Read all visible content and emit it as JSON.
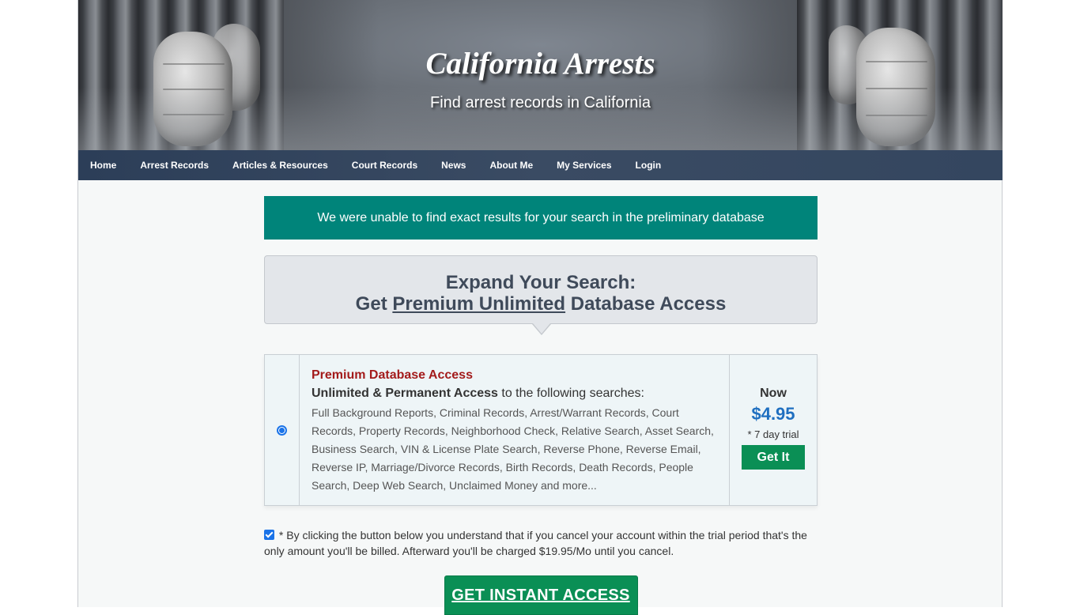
{
  "header": {
    "title": "California Arrests",
    "tagline": "Find arrest records in California"
  },
  "nav": {
    "items": [
      {
        "label": "Home"
      },
      {
        "label": "Arrest Records"
      },
      {
        "label": "Articles & Resources"
      },
      {
        "label": "Court Records"
      },
      {
        "label": "News"
      },
      {
        "label": "About Me"
      },
      {
        "label": "My Services"
      },
      {
        "label": "Login"
      }
    ]
  },
  "notice": {
    "text": "We were unable to find exact results for your search in the preliminary database",
    "color": "#00847a"
  },
  "expand": {
    "line1": "Expand Your Search:",
    "line2_prefix": "Get ",
    "line2_link": "Premium Unlimited",
    "line2_suffix": " Database Access"
  },
  "plan": {
    "selected": true,
    "title": "Premium Database Access",
    "subtitle_bold": "Unlimited & Permanent Access",
    "subtitle_rest": " to the following searches:",
    "features": "Full Background Reports, Criminal Records, Arrest/Warrant Records, Court Records, Property Records, Neighborhood Check, Relative Search, Asset Search, Business Search, VIN & License Plate Search, Reverse Phone, Reverse Email, Reverse IP, Marriage/Divorce Records, Birth Records, Death Records, People Search, Deep Web Search, Unclaimed Money and more...",
    "price_label": "Now",
    "price": "$4.95",
    "trial": "* 7 day trial",
    "button_label": "Get It"
  },
  "terms": {
    "checked": true,
    "text": "* By clicking the button below you understand that if you cancel your account within the trial period that's the only amount you'll be billed. Afterward you'll be charged $19.95/Mo until you cancel."
  },
  "cta": {
    "label": "GET INSTANT ACCESS",
    "color": "#0a8f55"
  }
}
